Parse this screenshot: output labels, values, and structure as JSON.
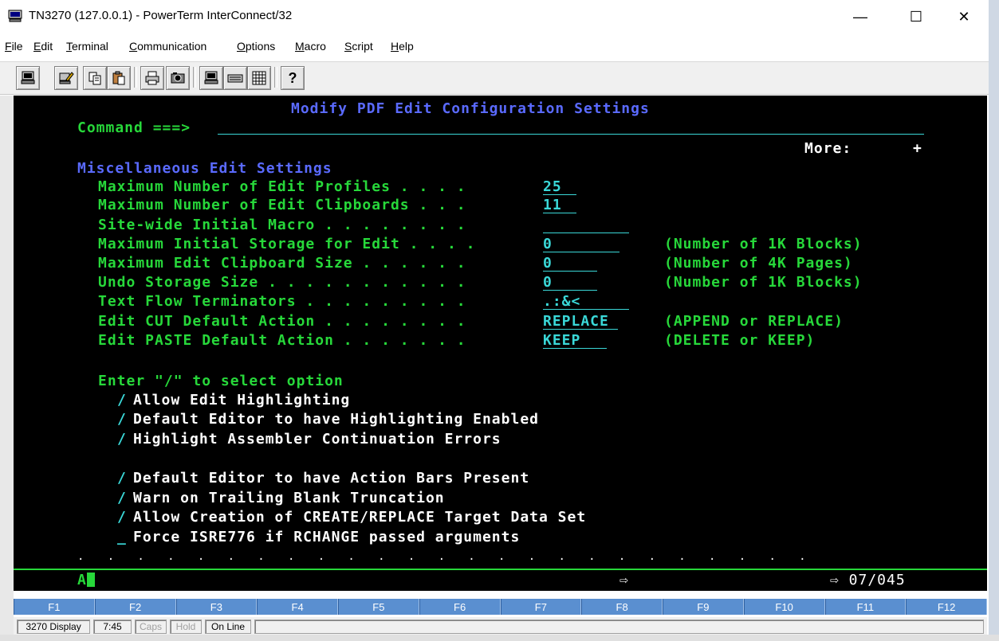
{
  "window": {
    "title": "TN3270 (127.0.0.1) - PowerTerm InterConnect/32",
    "minimize": "—",
    "maximize": "☐",
    "close": "✕"
  },
  "menu": [
    {
      "label": "File",
      "key": "F",
      "rest": "ile"
    },
    {
      "label": "Edit",
      "key": "E",
      "rest": "dit"
    },
    {
      "label": "Terminal",
      "key": "T",
      "rest": "erminal"
    },
    {
      "label": "Communication",
      "key": "C",
      "rest": "ommunication"
    },
    {
      "label": "Options",
      "key": "O",
      "rest": "ptions"
    },
    {
      "label": "Macro",
      "key": "M",
      "rest": "acro"
    },
    {
      "label": "Script",
      "key": "S",
      "rest": "cript"
    },
    {
      "label": "Help",
      "key": "H",
      "rest": "elp"
    }
  ],
  "toolbar": {
    "icons": [
      "terminal-icon",
      "edit-terminal-icon",
      "copy-icon",
      "paste-icon",
      "print-icon",
      "camera-icon",
      "session-icon",
      "keyboard-icon",
      "grid-icon",
      "help-icon"
    ],
    "help_glyph": "?"
  },
  "screen": {
    "title": "Modify PDF Edit Configuration Settings",
    "command_label": "Command ===>",
    "more_label": "More:",
    "more_indicator": "+",
    "section_heading": "Miscellaneous Edit Settings",
    "settings": [
      {
        "label": "Maximum Number of Edit Profiles . . . .",
        "value": "25",
        "hint": ""
      },
      {
        "label": "Maximum Number of Edit Clipboards . . .",
        "value": "11",
        "hint": ""
      },
      {
        "label": "Site-wide Initial Macro . . . . . . . .",
        "value": "",
        "hint": ""
      },
      {
        "label": "Maximum Initial Storage for Edit . . . .",
        "value": "0",
        "hint": "(Number of 1K Blocks)"
      },
      {
        "label": "Maximum Edit Clipboard Size . . . . . .",
        "value": "0",
        "hint": "(Number of 4K Pages)"
      },
      {
        "label": "Undo Storage Size . . . . . . . . . . .",
        "value": "0",
        "hint": "(Number of 1K Blocks)"
      },
      {
        "label": "Text Flow Terminators . . . . . . . . .",
        "value": ".:&<",
        "hint": ""
      },
      {
        "label": "Edit CUT Default Action . . . . . . . .",
        "value": "REPLACE",
        "hint": "(APPEND or REPLACE)"
      },
      {
        "label": "Edit PASTE Default Action . . . . . . .",
        "value": "KEEP",
        "hint": "(DELETE or KEEP)"
      }
    ],
    "select_prompt": "Enter \"/\" to select option",
    "options": [
      {
        "mark": "/",
        "label": "Allow Edit Highlighting"
      },
      {
        "mark": "/",
        "label": "Default Editor to have Highlighting Enabled"
      },
      {
        "mark": "/",
        "label": "Highlight Assembler Continuation Errors"
      },
      {
        "mark": "/",
        "label": "Default Editor to have Action Bars Present"
      },
      {
        "mark": "/",
        "label": "Warn on Trailing Blank Truncation"
      },
      {
        "mark": "/",
        "label": "Allow Creation of CREATE/REPLACE Target Data Set"
      },
      {
        "mark": "_",
        "label": "Force ISRE776 if RCHANGE passed arguments"
      }
    ],
    "dots_line": ".   .   .   .   .   .   .   .   .   .   .   .   .   .   .   .   .   .   .   .   .   .   .   .   .",
    "oia_left": "A",
    "oia_arrow": "⇨",
    "oia_right": "⇨ 07/045"
  },
  "fkeys": [
    "F1",
    "F2",
    "F3",
    "F4",
    "F5",
    "F6",
    "F7",
    "F8",
    "F9",
    "F10",
    "F11",
    "F12"
  ],
  "statusbar": {
    "display": "3270 Display",
    "time": "7:45",
    "caps": "Caps",
    "hold": "Hold",
    "online": "On Line"
  }
}
